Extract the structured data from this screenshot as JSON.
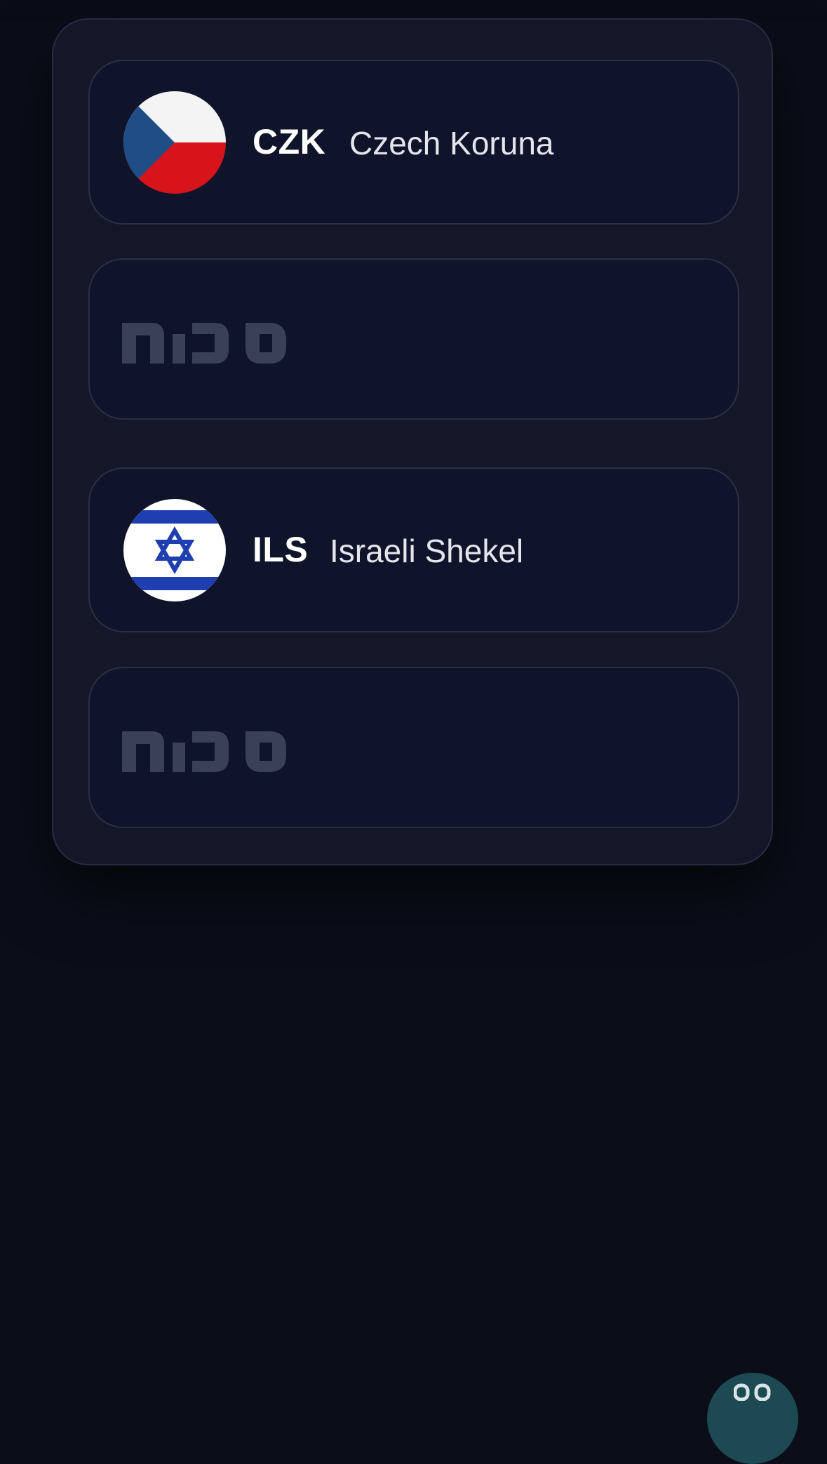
{
  "currencies": [
    {
      "code": "CZK",
      "name": "Czech Koruna",
      "flag_icon": "czech-flag-icon",
      "flag_colors": {
        "white": "#ffffff",
        "red": "#d7141a",
        "blue": "#11457e"
      }
    },
    {
      "code": "ILS",
      "name": "Israeli Shekel",
      "flag_icon": "israel-flag-icon",
      "flag_colors": {
        "white": "#ffffff",
        "blue": "#0038b8"
      }
    }
  ],
  "ad_placeholders": [
    {
      "logo_icon": "sponsor-logo-icon",
      "logo_color": "#394058"
    },
    {
      "logo_icon": "sponsor-logo-icon",
      "logo_color": "#394058"
    }
  ],
  "colors": {
    "background": "#0b0e19",
    "panel": "#131728",
    "card": "#10142a",
    "card_border": "#2a2f44",
    "fab": "#1d4a52"
  },
  "fab": {
    "icon": "chat-icon"
  }
}
